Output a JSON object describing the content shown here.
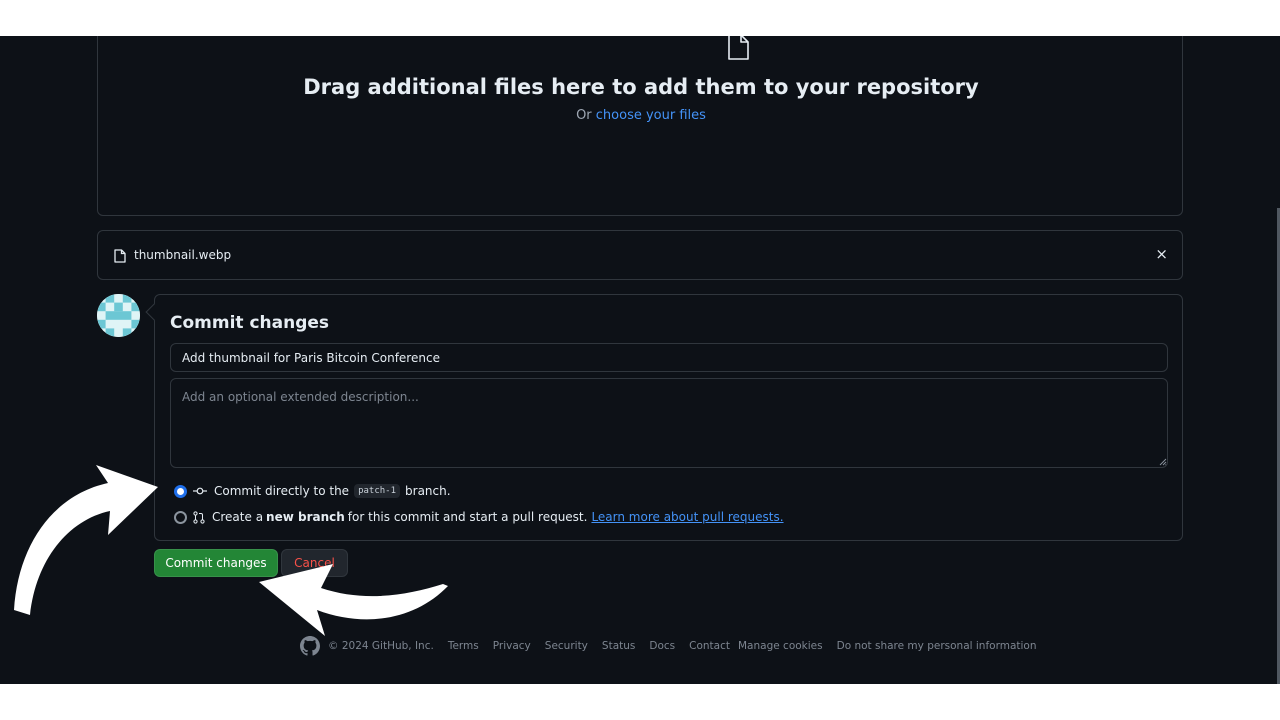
{
  "dropzone": {
    "title": "Drag additional files here to add them to your repository",
    "sub_prefix": "Or",
    "choose_link": "choose your files"
  },
  "file": {
    "name": "thumbnail.webp",
    "remove_icon": "×"
  },
  "commit": {
    "title": "Commit changes",
    "message_value": "Add thumbnail for Paris Bitcoin Conference",
    "description_placeholder": "Add an optional extended description...",
    "option_direct": {
      "prefix": "Commit directly to the",
      "branch": "patch-1",
      "suffix": "branch.",
      "selected": true
    },
    "option_new_branch": {
      "prefix": "Create a",
      "bold": "new branch",
      "suffix": "for this commit and start a pull request.",
      "link": "Learn more about pull requests.",
      "selected": false
    }
  },
  "buttons": {
    "commit": "Commit changes",
    "cancel": "Cancel"
  },
  "footer": {
    "copyright": "© 2024 GitHub, Inc.",
    "links": [
      "Terms",
      "Privacy",
      "Security",
      "Status",
      "Docs",
      "Contact",
      "Manage cookies",
      "Do not share my personal information"
    ]
  },
  "colors": {
    "background": "#0d1117",
    "border": "#30363d",
    "link": "#4493f8",
    "primary_button": "#238636",
    "danger_text": "#f85149"
  }
}
